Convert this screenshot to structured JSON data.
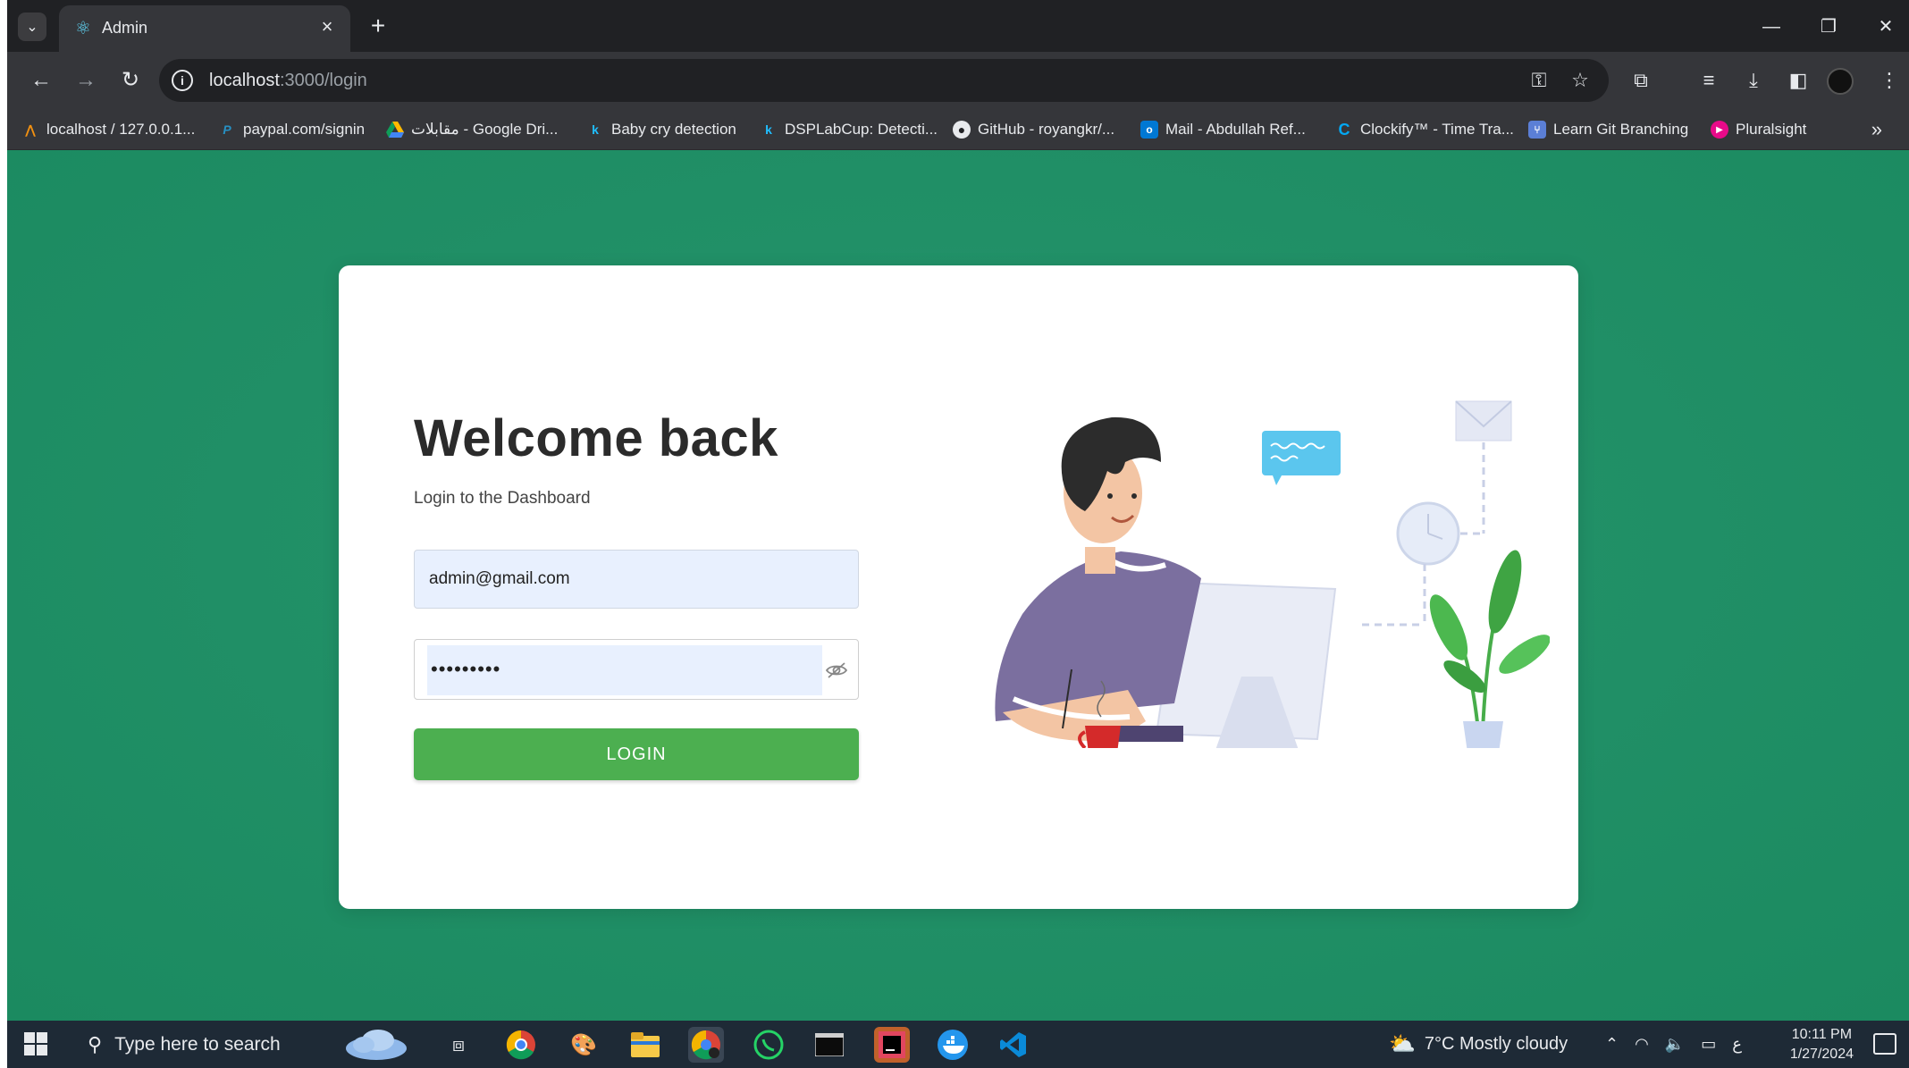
{
  "browser": {
    "tab_title": "Admin",
    "url_host": "localhost",
    "url_path": ":3000/login",
    "bookmarks": [
      {
        "label": "localhost / 127.0.0.1...",
        "icon": "phpmyadmin-icon"
      },
      {
        "label": "paypal.com/signin",
        "icon": "paypal-icon"
      },
      {
        "label": "مقابلات - Google Dri...",
        "icon": "google-drive-icon"
      },
      {
        "label": "Baby cry detection",
        "icon": "kaggle-icon"
      },
      {
        "label": "DSPLabCup: Detecti...",
        "icon": "kaggle-icon"
      },
      {
        "label": "GitHub - royangkr/...",
        "icon": "github-icon"
      },
      {
        "label": "Mail - Abdullah Ref...",
        "icon": "outlook-icon"
      },
      {
        "label": "Clockify™ - Time Tra...",
        "icon": "clockify-icon"
      },
      {
        "label": "Learn Git Branching",
        "icon": "git-icon"
      },
      {
        "label": "Pluralsight",
        "icon": "pluralsight-icon"
      }
    ]
  },
  "login": {
    "title": "Welcome back",
    "subtitle": "Login to the Dashboard",
    "email_value": "admin@gmail.com",
    "password_value": "•••••••••",
    "button_label": "LOGIN"
  },
  "taskbar": {
    "search_placeholder": "Type here to search",
    "weather": "7°C  Mostly cloudy",
    "time": "10:11 PM",
    "date": "1/27/2024",
    "lang": "ع"
  },
  "colors": {
    "page_green": "#219067",
    "login_button": "#4caf50",
    "input_fill": "#e8f0fe"
  }
}
